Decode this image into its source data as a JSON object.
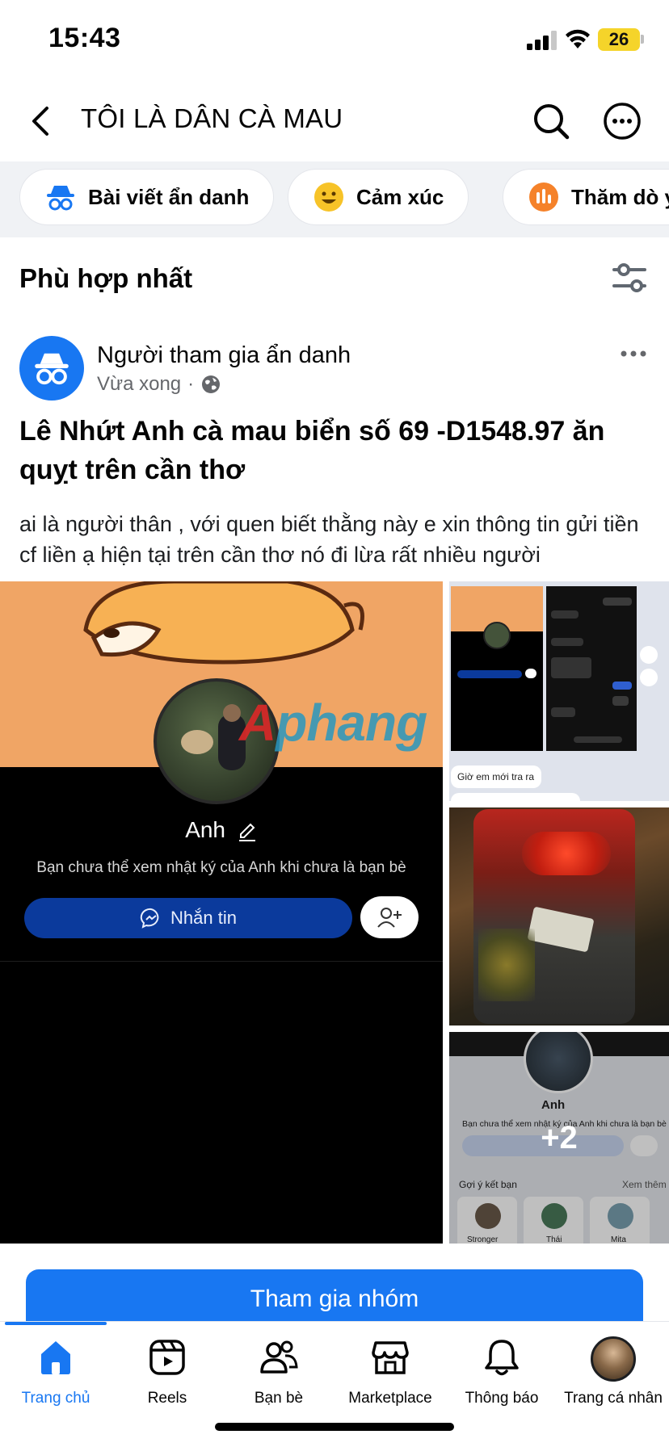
{
  "status": {
    "time": "15:43",
    "battery": "26"
  },
  "header": {
    "title": "TÔI LÀ DÂN CÀ MAU"
  },
  "chips": [
    {
      "label": "Bài viết ẩn danh",
      "icon": "anonymous-icon"
    },
    {
      "label": "Cảm xúc",
      "icon": "emoji-icon"
    },
    {
      "label": "Thăm dò ý",
      "icon": "poll-icon"
    }
  ],
  "sort": {
    "label": "Phù hợp nhất"
  },
  "post": {
    "author": "Người tham gia ẩn danh",
    "time": "Vừa xong",
    "separator": "·",
    "title": "Lê Nhứt Anh cà mau biển số 69 -D1548.97 ăn quỵt trên cần thơ",
    "body": "ai là người thân , với quen biết thằng này e xin thông tin gửi tiền cf liền ạ hiện tại trên cần thơ nó đi lừa rất nhiều người",
    "media": {
      "main": {
        "profile_name": "Anh",
        "profile_note": "Bạn chưa thể xem nhật ký của Anh khi chưa là bạn bè",
        "message_button": "Nhắn tin",
        "watermark": "Aphang"
      },
      "thumb1": {
        "reply_text": "Giờ em mới tra ra"
      },
      "thumb3": {
        "profile_name": "Anh",
        "profile_note": "Bạn chưa thể xem nhật ký của Anh khi chưa là bạn bè",
        "suggest_label": "Gợi ý kết bạn",
        "see_more": "Xem thêm",
        "friends": [
          "Stronger",
          "Thái",
          "Mita"
        ]
      },
      "more_count": "+2"
    }
  },
  "join_button": "Tham gia nhóm",
  "nav": [
    {
      "label": "Trang chủ",
      "active": true
    },
    {
      "label": "Reels",
      "active": false
    },
    {
      "label": "Bạn bè",
      "active": false
    },
    {
      "label": "Marketplace",
      "active": false
    },
    {
      "label": "Thông báo",
      "active": false
    },
    {
      "label": "Trang cá nhân",
      "active": false
    }
  ],
  "colors": {
    "accent": "#1877f2",
    "chips_bg": "#f0f2f5",
    "battery": "#f5d42a"
  }
}
